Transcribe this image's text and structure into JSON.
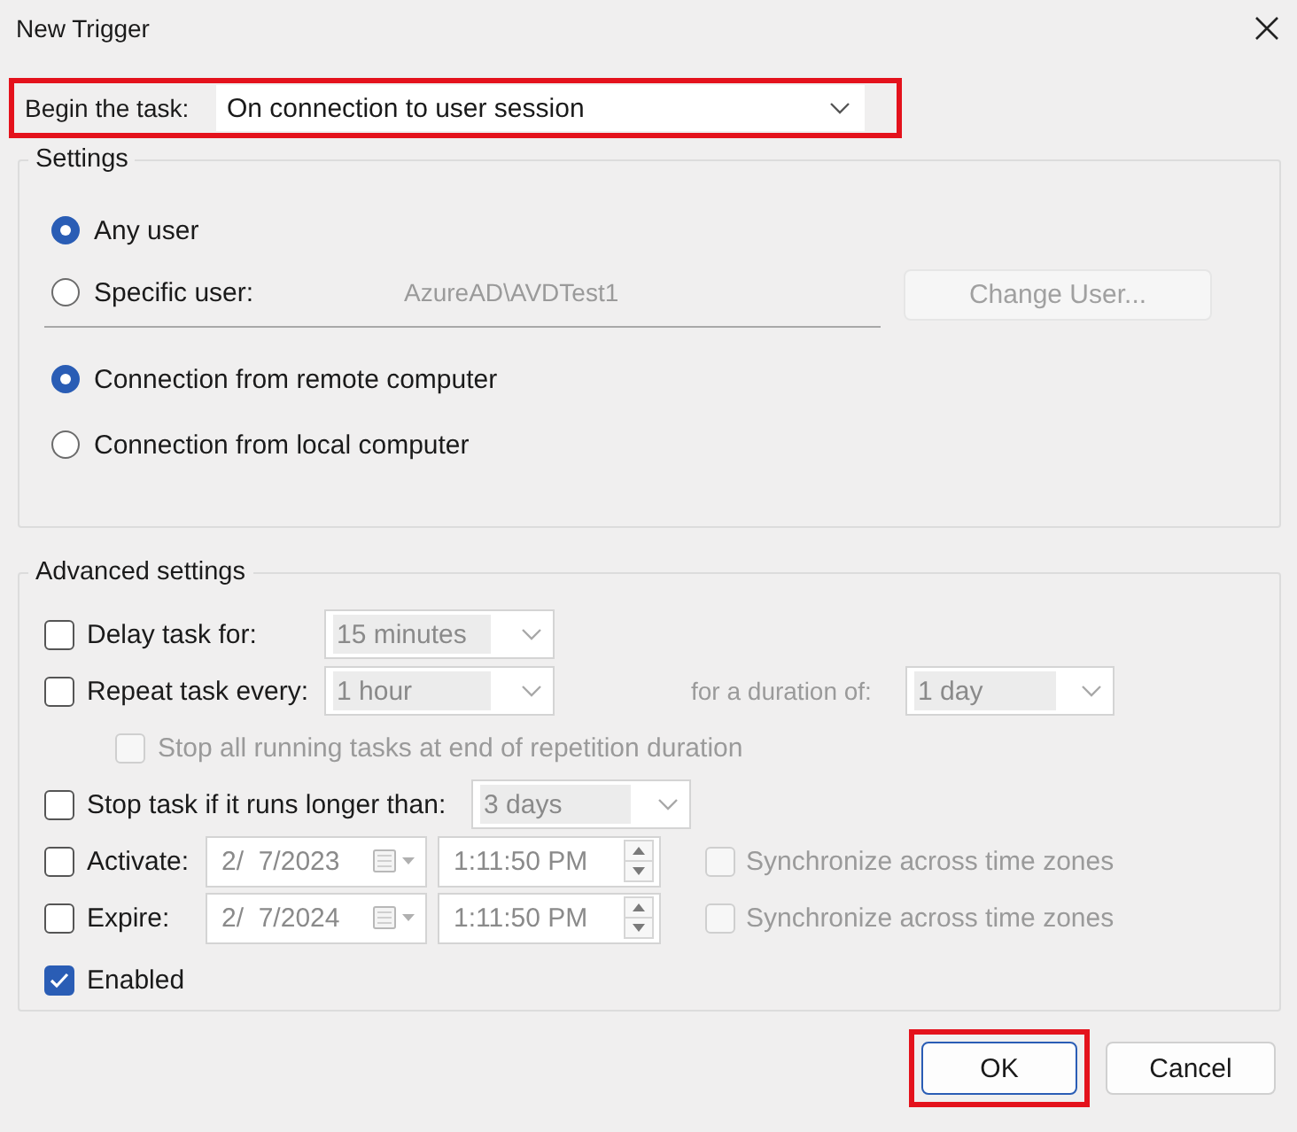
{
  "window": {
    "title": "New Trigger"
  },
  "begin_task": {
    "label": "Begin the task:",
    "value": "On connection to user session",
    "highlighted": true
  },
  "settings": {
    "title": "Settings",
    "user_options": [
      {
        "label": "Any user",
        "selected": true
      },
      {
        "label": "Specific user:",
        "selected": false,
        "account": "AzureAD\\AVDTest1"
      }
    ],
    "change_user_button": {
      "label": "Change User...",
      "disabled": true
    },
    "connection_options": [
      {
        "label": "Connection from remote computer",
        "selected": true
      },
      {
        "label": "Connection from local computer",
        "selected": false
      }
    ]
  },
  "advanced": {
    "title": "Advanced settings",
    "delay": {
      "label": "Delay task for:",
      "checked": false,
      "value": "15 minutes"
    },
    "repeat": {
      "label": "Repeat task every:",
      "checked": false,
      "value": "1 hour",
      "duration_label": "for a duration of:",
      "duration_value": "1 day"
    },
    "stop_all": {
      "label": "Stop all running tasks at end of repetition duration",
      "checked": false,
      "disabled": true
    },
    "stop_longer": {
      "label": "Stop task if it runs longer than:",
      "checked": false,
      "value": "3 days"
    },
    "schedule": [
      {
        "label": "Activate:",
        "checked": false,
        "date": "2/  7/2023",
        "time": "1:11:50 PM",
        "sync_label": "Synchronize across time zones",
        "sync_checked": false
      },
      {
        "label": "Expire:",
        "checked": false,
        "date": "2/  7/2024",
        "time": "1:11:50 PM",
        "sync_label": "Synchronize across time zones",
        "sync_checked": false
      }
    ],
    "enabled": {
      "label": "Enabled",
      "checked": true
    }
  },
  "buttons": [
    {
      "label": "OK",
      "highlighted": true,
      "default": true
    },
    {
      "label": "Cancel",
      "highlighted": false,
      "default": false
    }
  ]
}
